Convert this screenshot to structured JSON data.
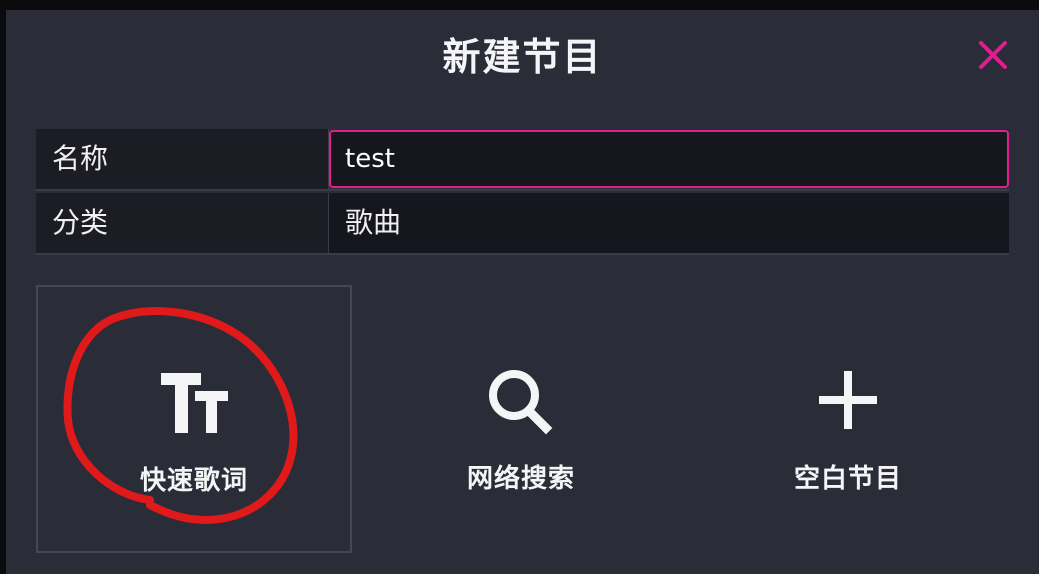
{
  "dialog": {
    "title": "新建节目",
    "close_icon": "close-icon",
    "accent_color": "#e01e8e"
  },
  "form": {
    "name": {
      "label": "名称",
      "value": "test"
    },
    "category": {
      "label": "分类",
      "value": "歌曲"
    }
  },
  "options": [
    {
      "label": "快速歌词",
      "icon": "text-size-icon"
    },
    {
      "label": "网络搜索",
      "icon": "search-icon"
    },
    {
      "label": "空白节目",
      "icon": "plus-icon"
    }
  ],
  "annotation": {
    "shape": "freehand-circle",
    "color": "#e01a1a",
    "target": "快速歌词"
  }
}
